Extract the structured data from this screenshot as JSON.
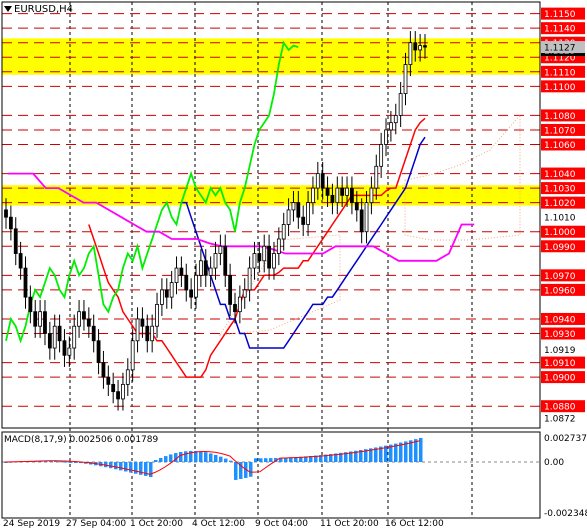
{
  "title": {
    "symbol": "EURUSD,H4"
  },
  "price_axis": {
    "ticks": [
      "1.1150",
      "1.1140",
      "1.1130",
      "1.1120",
      "1.1110",
      "1.1100",
      "1.1080",
      "1.1070",
      "1.1060",
      "1.1040",
      "1.1030",
      "1.1020",
      "1.1010",
      "1.1000",
      "1.0990",
      "1.0970",
      "1.0960",
      "1.0940",
      "1.0930",
      "1.0919",
      "1.0910",
      "1.0900",
      "1.0880",
      "1.0872"
    ],
    "highlighted": [
      "1.1150",
      "1.1140",
      "1.1130",
      "1.1120",
      "1.1110",
      "1.1100",
      "1.1080",
      "1.1070",
      "1.1060",
      "1.1040",
      "1.1030",
      "1.1020",
      "1.1000",
      "1.0990",
      "1.0970",
      "1.0960",
      "1.0940",
      "1.0930",
      "1.0910",
      "1.0900",
      "1.0880"
    ],
    "current_price": "1.1125",
    "current_bid": "1.1127"
  },
  "time_axis": {
    "labels": [
      "24 Sep 2019",
      "27 Sep 04:00",
      "1 Oct 20:00",
      "4 Oct 12:00",
      "9 Oct 04:00",
      "11 Oct 20:00",
      "16 Oct 12:00"
    ]
  },
  "macd": {
    "label": "MACD(8,17,9) 0.002506 0.001789",
    "axis": [
      "0.002737",
      "0.00",
      "-0.002348"
    ]
  },
  "colors": {
    "level_line": "#cc0000",
    "zone": "#ffff00",
    "label_bg": "#ff0000",
    "histogram": "#1e90ff",
    "signal": "#ff0000",
    "tenkan": "#ff0000",
    "kijun": "#0000cc",
    "chikou": "#00ee00",
    "senkou_b": "#ff00ff",
    "cloud": "#f4a582"
  },
  "chart_data": {
    "type": "candlestick",
    "symbol": "EURUSD",
    "timeframe": "H4",
    "ylim": [
      1.0865,
      1.1158
    ],
    "support_resistance_levels": [
      1.115,
      1.114,
      1.113,
      1.112,
      1.111,
      1.11,
      1.108,
      1.107,
      1.106,
      1.104,
      1.103,
      1.102,
      1.1,
      1.099,
      1.097,
      1.096,
      1.094,
      1.093,
      1.091,
      1.09,
      1.088
    ],
    "zones": [
      [
        1.1108,
        1.1133
      ],
      [
        1.1018,
        1.1032
      ]
    ],
    "close": [
      1.101,
      1.1002,
      1.0985,
      1.0975,
      1.0955,
      1.0945,
      1.0935,
      1.0945,
      1.093,
      1.092,
      1.0935,
      1.0925,
      1.0915,
      1.092,
      1.0935,
      1.0945,
      1.094,
      1.0935,
      1.0925,
      1.091,
      1.09,
      1.0895,
      1.089,
      1.0885,
      1.0895,
      1.0905,
      1.0925,
      1.094,
      1.0935,
      1.0925,
      1.0935,
      1.095,
      1.096,
      1.0955,
      1.0965,
      1.0975,
      1.097,
      1.096,
      1.0955,
      1.097,
      1.098,
      1.097,
      1.0975,
      1.0985,
      1.099,
      1.097,
      1.095,
      1.0945,
      1.0955,
      1.096,
      1.0975,
      1.0985,
      1.098,
      1.099,
      1.0975,
      1.0985,
      1.0995,
      1.1005,
      1.1015,
      1.102,
      1.101,
      1.1005,
      1.102,
      1.103,
      1.104,
      1.103,
      1.1025,
      1.102,
      1.103,
      1.1025,
      1.103,
      1.102,
      1.1015,
      1.1,
      1.102,
      1.103,
      1.1045,
      1.106,
      1.107,
      1.1075,
      1.108,
      1.1095,
      1.1115,
      1.113,
      1.1125,
      1.1128,
      1.1127
    ],
    "tenkan": [
      1.1005,
      1.0995,
      1.0985,
      1.0975,
      1.0965,
      1.096,
      1.0955,
      1.0945,
      1.094,
      1.0935,
      1.093,
      1.093,
      1.093,
      1.093,
      1.0925,
      1.0925,
      1.092,
      1.0915,
      1.091,
      1.0905,
      1.09,
      1.09,
      1.09,
      1.09,
      1.0905,
      1.0915,
      1.092,
      1.0925,
      1.093,
      1.0935,
      1.094,
      1.095,
      1.096,
      1.096,
      1.096,
      1.0965,
      1.097,
      1.097,
      1.097,
      1.0972,
      1.0975,
      1.0975,
      1.0975,
      1.0975,
      1.098,
      1.098,
      1.0985,
      1.099,
      1.0995,
      1.1,
      1.1005,
      1.101,
      1.1015,
      1.102,
      1.1025,
      1.1025,
      1.1025,
      1.1025,
      1.1025,
      1.1025,
      1.1025,
      1.1028,
      1.103,
      1.103,
      1.104,
      1.105,
      1.106,
      1.107,
      1.1075,
      1.1078
    ],
    "kijun": [
      1.102,
      1.102,
      1.101,
      1.1,
      1.099,
      1.098,
      1.097,
      1.096,
      1.095,
      1.095,
      1.094,
      1.094,
      1.093,
      1.093,
      1.092,
      1.092,
      1.092,
      1.092,
      1.092,
      1.092,
      1.092,
      1.092,
      1.0925,
      1.093,
      1.0935,
      1.094,
      1.0945,
      1.095,
      1.095,
      1.095,
      1.0955,
      1.0955,
      1.096,
      1.0965,
      1.097,
      1.0975,
      1.098,
      1.0985,
      1.099,
      1.0995,
      1.1,
      1.1005,
      1.101,
      1.1015,
      1.102,
      1.1025,
      1.103,
      1.104,
      1.105,
      1.106,
      1.1065
    ]
  }
}
